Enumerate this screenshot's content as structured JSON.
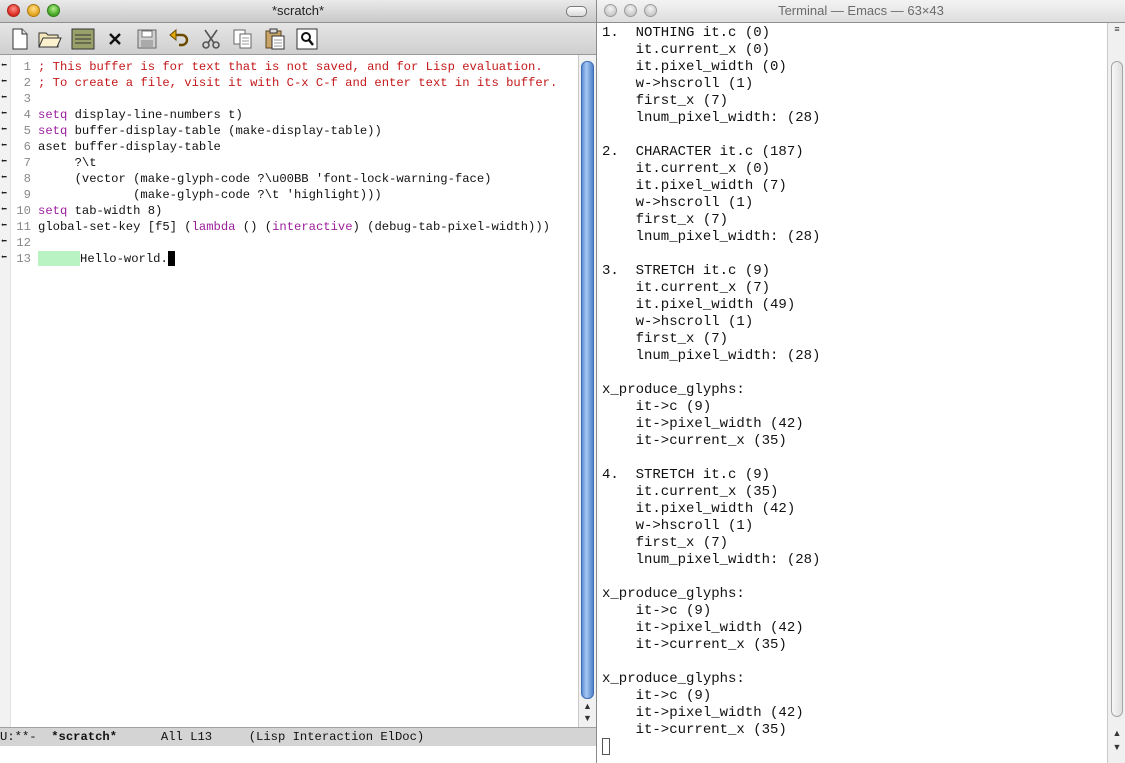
{
  "emacs": {
    "title": "*scratch*",
    "toolbar": [
      "new-file-icon",
      "open-folder-icon",
      "dired-icon",
      "close-buffer-icon",
      "save-icon",
      "undo-icon",
      "cut-icon",
      "copy-icon",
      "paste-icon",
      "search-icon"
    ],
    "lines": [
      {
        "num": "1",
        "segs": [
          {
            "t": "; This buffer is for text that is not saved, and for Lisp evaluation.",
            "c": "comment"
          }
        ]
      },
      {
        "num": "2",
        "segs": [
          {
            "t": "; To create a file, visit it with C-x C-f and enter text in its buffer.",
            "c": "comment"
          }
        ]
      },
      {
        "num": "3",
        "segs": []
      },
      {
        "num": "4",
        "segs": [
          {
            "t": "setq",
            "c": "kw"
          },
          {
            "t": " display-line-numbers t)"
          }
        ]
      },
      {
        "num": "5",
        "segs": [
          {
            "t": "setq",
            "c": "kw"
          },
          {
            "t": " buffer-display-table (make-display-table))"
          }
        ]
      },
      {
        "num": "6",
        "segs": [
          {
            "t": "aset buffer-display-table"
          }
        ]
      },
      {
        "num": "7",
        "segs": [
          {
            "t": "     ?\\t"
          }
        ]
      },
      {
        "num": "8",
        "segs": [
          {
            "t": "     (vector (make-glyph-code ?\\u00BB 'font-lock-warning-face)"
          }
        ]
      },
      {
        "num": "9",
        "segs": [
          {
            "t": "             (make-glyph-code ?\\t 'highlight)))"
          }
        ]
      },
      {
        "num": "10",
        "segs": [
          {
            "t": "setq",
            "c": "kw"
          },
          {
            "t": " tab-width 8)"
          }
        ]
      },
      {
        "num": "11",
        "segs": [
          {
            "t": "global-set-key [f5] ("
          },
          {
            "t": "lambda",
            "c": "kw"
          },
          {
            "t": " () ("
          },
          {
            "t": "interactive",
            "c": "kw"
          },
          {
            "t": ") (debug-tab-pixel-width)))"
          }
        ]
      },
      {
        "num": "12",
        "segs": []
      },
      {
        "num": "13",
        "segs": [
          {
            "t": "",
            "c": "stretch"
          },
          {
            "t": "Hello-world."
          },
          {
            "t": "",
            "c": "cursor"
          }
        ]
      }
    ],
    "modeline": {
      "status": "U:**-  ",
      "buffer": "*scratch*",
      "position": "      All L13     ",
      "modes": "(Lisp Interaction ElDoc)"
    }
  },
  "terminal": {
    "title": "Terminal — Emacs — 63×43",
    "lines": [
      "1.  NOTHING it.c (0)",
      "    it.current_x (0)",
      "    it.pixel_width (0)",
      "    w->hscroll (1)",
      "    first_x (7)",
      "    lnum_pixel_width: (28)",
      "",
      "2.  CHARACTER it.c (187)",
      "    it.current_x (0)",
      "    it.pixel_width (7)",
      "    w->hscroll (1)",
      "    first_x (7)",
      "    lnum_pixel_width: (28)",
      "",
      "3.  STRETCH it.c (9)",
      "    it.current_x (7)",
      "    it.pixel_width (49)",
      "    w->hscroll (1)",
      "    first_x (7)",
      "    lnum_pixel_width: (28)",
      "",
      "x_produce_glyphs:",
      "    it->c (9)",
      "    it->pixel_width (42)",
      "    it->current_x (35)",
      "",
      "4.  STRETCH it.c (9)",
      "    it.current_x (35)",
      "    it.pixel_width (42)",
      "    w->hscroll (1)",
      "    first_x (7)",
      "    lnum_pixel_width: (28)",
      "",
      "x_produce_glyphs:",
      "    it->c (9)",
      "    it->pixel_width (42)",
      "    it->current_x (35)",
      "",
      "x_produce_glyphs:",
      "    it->c (9)",
      "    it->pixel_width (42)",
      "    it->current_x (35)"
    ]
  }
}
